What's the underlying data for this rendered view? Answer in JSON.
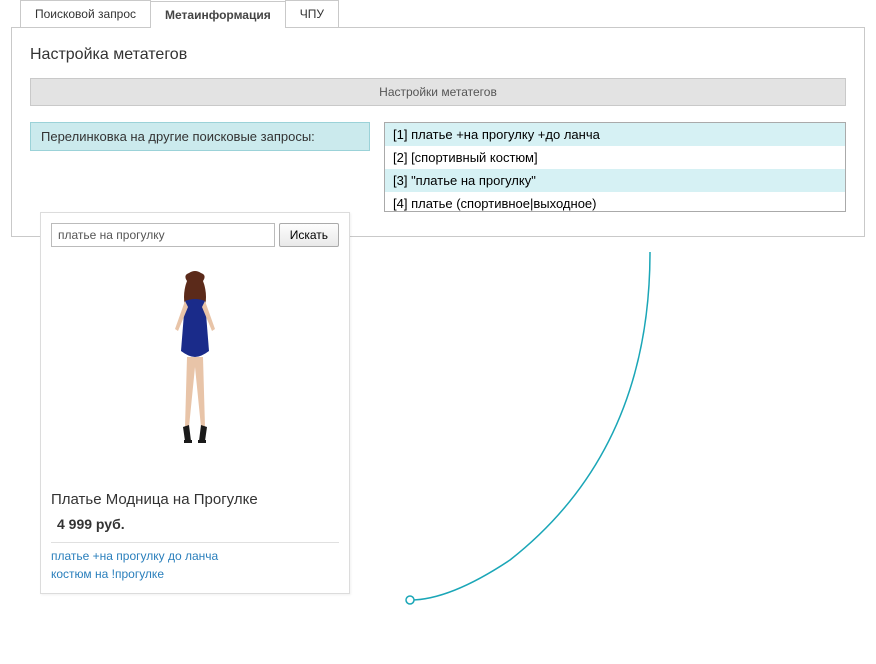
{
  "tabs": {
    "search": "Поисковой запрос",
    "meta": "Метаинформация",
    "sef": "ЧПУ"
  },
  "panel": {
    "title": "Настройка метатегов",
    "section_header": "Настройки метатегов",
    "interlink_label": "Перелинковка на другие поисковые запросы:"
  },
  "options": [
    "[1] платье +на прогулку +до ланча",
    "[2] [спортивный костюм]",
    "[3] \"платье на прогулку\"",
    "[4] платье (спортивное|выходное)"
  ],
  "preview": {
    "search_value": "платье на прогулку",
    "search_button": "Искать",
    "product_title": "Платье Модница на Прогулке",
    "product_price": "4 999 руб.",
    "links": [
      "платье +на прогулку до ланча",
      "костюм на !прогулке"
    ]
  }
}
